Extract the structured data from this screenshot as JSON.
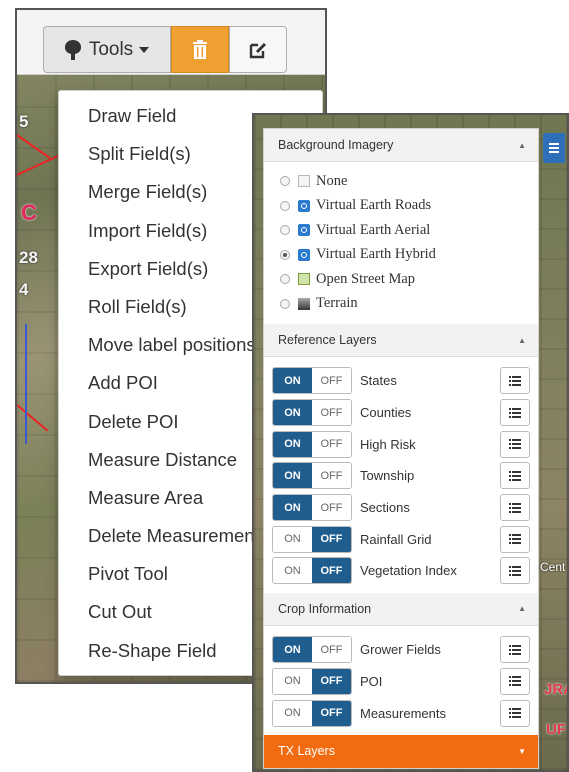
{
  "toolbar": {
    "tools_label": "Tools",
    "icons": [
      "tree-icon",
      "caret-down-icon",
      "trash-icon",
      "edit-icon"
    ],
    "colors": {
      "trash_button": "#f0a030",
      "toolbar_bg": "#f4f4f4"
    }
  },
  "tools_menu": {
    "items": [
      "Draw Field",
      "Split Field(s)",
      "Merge Field(s)",
      "Import Field(s)",
      "Export Field(s)",
      "Roll Field(s)",
      "Move label positions",
      "Add POI",
      "Delete POI",
      "Measure Distance",
      "Measure Area",
      "Delete Measurements",
      "Pivot Tool",
      "Cut Out",
      "Re-Shape Field"
    ]
  },
  "map_labels": {
    "l1": "5",
    "l2": "C",
    "l3": "28",
    "l4": "4",
    "r1": "Cent",
    "r2": "JRA",
    "r3": "UF"
  },
  "background_imagery": {
    "title": "Background Imagery",
    "selected": "Virtual Earth Hybrid",
    "options": [
      {
        "label": "None",
        "icon": "blank-icon"
      },
      {
        "label": "Virtual Earth Roads",
        "icon": "virtual-earth-icon"
      },
      {
        "label": "Virtual Earth Aerial",
        "icon": "virtual-earth-icon"
      },
      {
        "label": "Virtual Earth Hybrid",
        "icon": "virtual-earth-icon"
      },
      {
        "label": "Open Street Map",
        "icon": "osm-icon"
      },
      {
        "label": "Terrain",
        "icon": "terrain-icon"
      }
    ]
  },
  "reference_layers": {
    "title": "Reference Layers",
    "on_label": "ON",
    "off_label": "OFF",
    "layers": [
      {
        "name": "States",
        "state": "on"
      },
      {
        "name": "Counties",
        "state": "on"
      },
      {
        "name": "High Risk",
        "state": "on"
      },
      {
        "name": "Township",
        "state": "on"
      },
      {
        "name": "Sections",
        "state": "on"
      },
      {
        "name": "Rainfall Grid",
        "state": "off"
      },
      {
        "name": "Vegetation Index",
        "state": "off"
      }
    ]
  },
  "crop_information": {
    "title": "Crop Information",
    "on_label": "ON",
    "off_label": "OFF",
    "layers": [
      {
        "name": "Grower Fields",
        "state": "on"
      },
      {
        "name": "POI",
        "state": "off"
      },
      {
        "name": "Measurements",
        "state": "off"
      }
    ]
  },
  "tx_layers": {
    "title": "TX Layers",
    "color": "#f26b10"
  },
  "colors": {
    "toggle_active": "#1f5d8f"
  }
}
